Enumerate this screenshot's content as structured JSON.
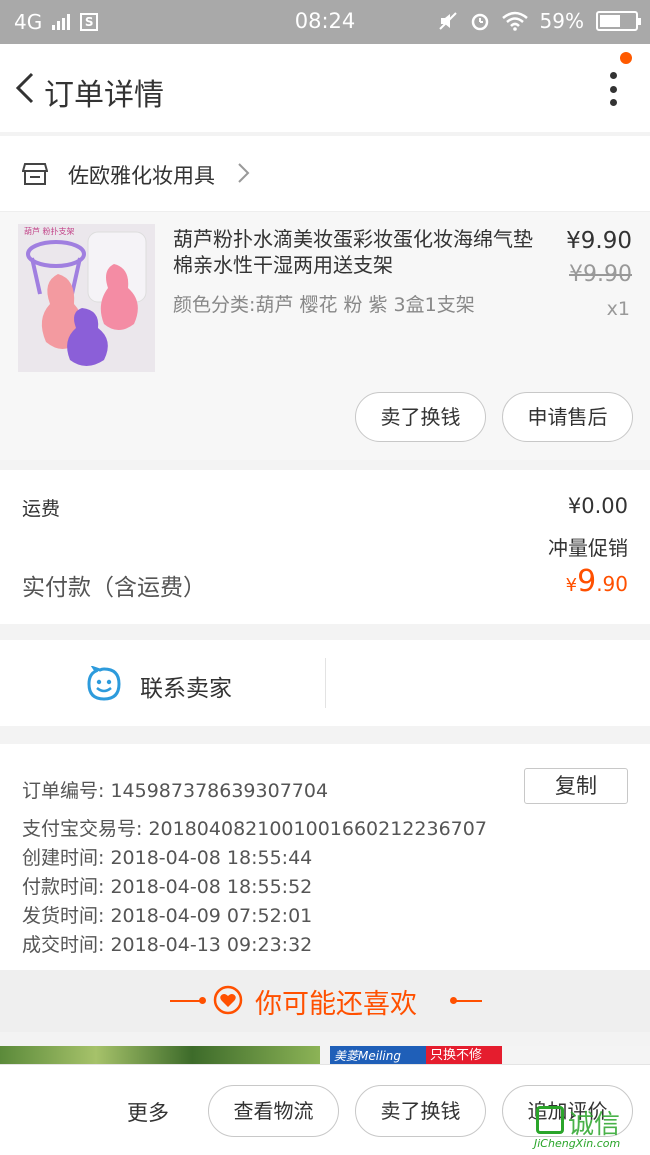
{
  "status_bar": {
    "network": "4G",
    "sim_label": "S",
    "time": "08:24",
    "battery_text": "59%",
    "battery_level": 0.59
  },
  "nav": {
    "title": "订单详情"
  },
  "shop": {
    "name": "佐欧雅化妆用具"
  },
  "item": {
    "title": "葫芦粉扑水滴美妆蛋彩妆蛋化妆海绵气垫棉亲水性干湿两用送支架",
    "sku": "颜色分类:葫芦 樱花 粉 紫 3盒1支架",
    "price": "¥9.90",
    "original_price": "¥9.90",
    "quantity": "x1",
    "actions": {
      "resell": "卖了换钱",
      "after_sale": "申请售后"
    }
  },
  "fees": {
    "shipping_label": "运费",
    "shipping_value": "¥0.00",
    "promotion": "冲量促销",
    "paid_label": "实付款（含运费）",
    "paid_currency": "¥",
    "paid_integer": "9",
    "paid_decimal": ".90"
  },
  "contact": {
    "label": "联系卖家"
  },
  "order_info": {
    "order_no_label": "订单编号:",
    "order_no": "145987378639307704",
    "copy_label": "复制",
    "alipay_label": "支付宝交易号:",
    "alipay_no": "2018040821001001660212236707",
    "created_label": "创建时间:",
    "created_at": "2018-04-08 18:55:44",
    "paid_label": "付款时间:",
    "paid_at": "2018-04-08 18:55:52",
    "shipped_label": "发货时间:",
    "shipped_at": "2018-04-09 07:52:01",
    "completed_label": "成交时间:",
    "completed_at": "2018-04-13 09:23:32"
  },
  "recommend": {
    "title": "你可能还喜欢",
    "ad_brand": "美菱Meiling",
    "ad_tag": "只换不修"
  },
  "bottom_bar": {
    "more": "更多",
    "logistics": "查看物流",
    "resell": "卖了换钱",
    "review": "追加评价"
  },
  "watermark": {
    "text": "诚信",
    "url": "JiChengXin.com"
  },
  "colors": {
    "accent": "#ff5000",
    "contact_icon": "#2d9bdc",
    "watermark": "#2aa52a"
  }
}
